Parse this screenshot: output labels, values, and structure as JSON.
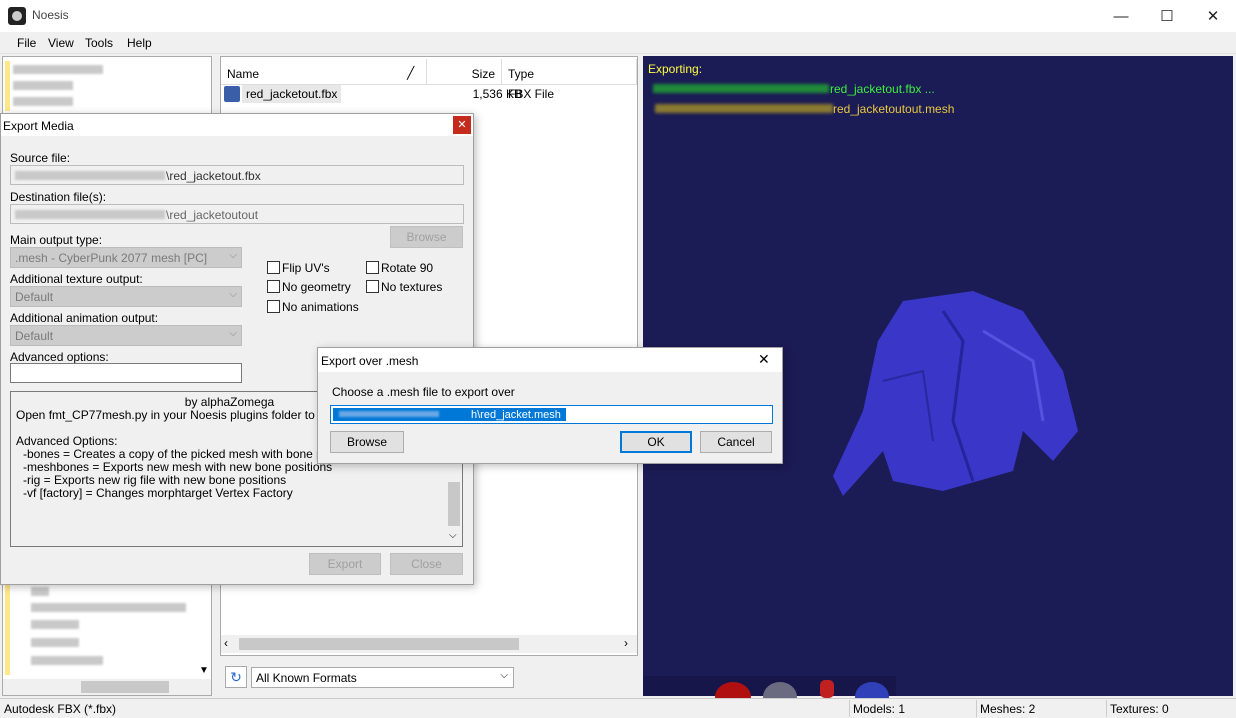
{
  "window": {
    "title": "Noesis",
    "minimize": "—",
    "maximize": "☐",
    "close": "✕"
  },
  "menu": [
    "File",
    "View",
    "Tools",
    "Help"
  ],
  "file_list": {
    "headers": {
      "name": "Name",
      "size": "Size",
      "type": "Type"
    },
    "rows": [
      {
        "name": "red_jacketout.fbx",
        "size": "1,536 KB",
        "type": "FBX File"
      }
    ]
  },
  "format_select": {
    "value": "All Known Formats"
  },
  "viewport": {
    "export_header": "Exporting:",
    "log_line1": "red_jacketout.fbx ...",
    "log_line2": "red_jacketoutout.mesh",
    "colors": {
      "background": "#1b1b55",
      "log1": "#3cf03c",
      "log2": "#e8c840",
      "header": "#ffff40"
    }
  },
  "status": {
    "format": "Autodesk FBX (*.fbx)",
    "models": "Models: 1",
    "meshes": "Meshes: 2",
    "textures": "Textures: 0"
  },
  "export_media": {
    "title": "Export Media",
    "source_label": "Source file:",
    "source_value": "\\red_jacketout.fbx",
    "dest_label": "Destination file(s):",
    "dest_value": "\\red_jacketoutout",
    "browse": "Browse",
    "main_output_label": "Main output type:",
    "main_output_value": ".mesh - CyberPunk 2077 mesh [PC]",
    "tex_output_label": "Additional texture output:",
    "tex_output_value": "Default",
    "anim_output_label": "Additional animation output:",
    "anim_output_value": "Default",
    "adv_label": "Advanced options:",
    "checks": {
      "flip_uvs": "Flip UV's",
      "rotate_90": "Rotate 90",
      "no_geometry": "No geometry",
      "no_textures": "No textures",
      "no_animations": "No animations"
    },
    "info": {
      "line1": "by alphaZomega",
      "line2": "Open fmt_CP77mesh.py in your Noesis plugins folder to change",
      "line3": "Advanced Options:",
      "line4": "-bones = Creates a copy of the picked mesh with bone positions",
      "line5": "-meshbones = Exports new mesh with new bone positions",
      "line6": "-rig = Exports new rig file with new bone positions",
      "line7": "-vf [factory] = Changes morphtarget Vertex Factory"
    },
    "export_btn": "Export",
    "close_btn": "Close"
  },
  "export_over": {
    "title": "Export over .mesh",
    "prompt": "Choose a .mesh file to export over",
    "path_value": "h\\red_jacket.mesh",
    "browse": "Browse",
    "ok": "OK",
    "cancel": "Cancel"
  }
}
